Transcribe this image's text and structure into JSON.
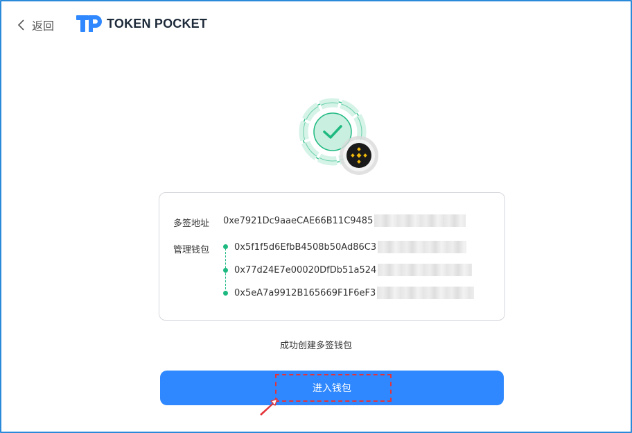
{
  "header": {
    "back_label": "返回",
    "logo_text": "TOKEN POCKET"
  },
  "card": {
    "multisig_label": "多签地址",
    "multisig_address": "0xe7921Dc9aaeCAE66B11C9485",
    "managers_label": "管理钱包",
    "managers": [
      "0x5f1f5d6EfbB4508b50Ad86C3",
      "0x77d24E7e00020DfDb51a524",
      "0x5eA7a9912B165669F1F6eF3"
    ]
  },
  "status": {
    "message": "成功创建多签钱包"
  },
  "actions": {
    "enter_wallet_label": "进入钱包"
  },
  "colors": {
    "primary": "#2f88ff",
    "success": "#1db980",
    "bnb": "#f0b90b",
    "frame": "#2a8ad9",
    "highlight": "#e3343a"
  },
  "icons": [
    "chevron-left-icon",
    "tp-logo-icon",
    "success-check-icon",
    "bnb-chain-icon",
    "arrow-cursor-icon"
  ]
}
